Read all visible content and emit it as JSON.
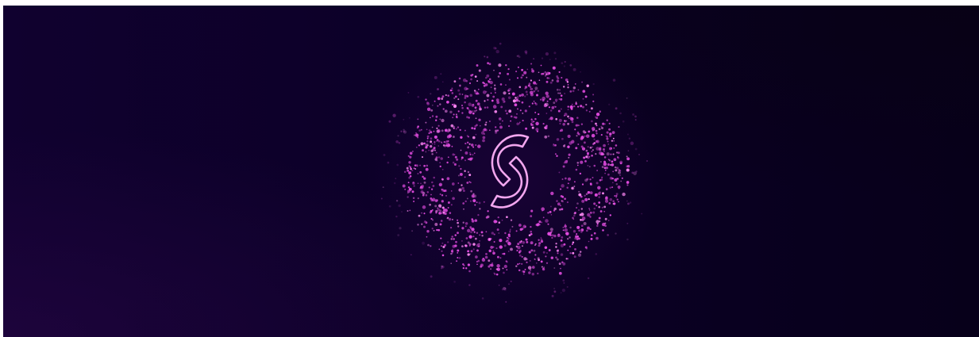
{
  "hero": {
    "background_start": "#10012f",
    "background_end": "#07001a",
    "particle_color": "#e24be0",
    "particle_highlight": "#ff8af5",
    "logo_outline_color": "#f2a6ee",
    "logo_icon": "s-monogram-icon"
  }
}
